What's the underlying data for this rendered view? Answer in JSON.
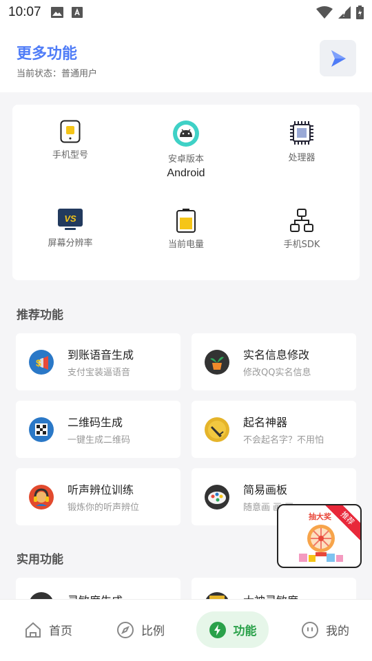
{
  "status_bar": {
    "time": "10:07"
  },
  "header": {
    "title": "更多功能",
    "status_label": "当前状态：",
    "status_value": "普通用户"
  },
  "device_info": {
    "items": [
      {
        "label": "手机型号",
        "value": "",
        "icon": "phone-icon"
      },
      {
        "label": "安卓版本",
        "value": "Android",
        "icon": "android-icon"
      },
      {
        "label": "处理器",
        "value": "",
        "icon": "cpu-icon"
      },
      {
        "label": "屏幕分辨率",
        "value": "",
        "icon": "monitor-icon"
      },
      {
        "label": "当前电量",
        "value": "",
        "icon": "battery-icon"
      },
      {
        "label": "手机SDK",
        "value": "",
        "icon": "hierarchy-icon"
      }
    ]
  },
  "recommended": {
    "title": "推荐功能",
    "items": [
      {
        "title": "到账语音生成",
        "subtitle": "支付宝装逼语音",
        "icon": "money-speaker-icon"
      },
      {
        "title": "实名信息修改",
        "subtitle": "修改QQ实名信息",
        "icon": "plant-pot-icon"
      },
      {
        "title": "二维码生成",
        "subtitle": "一键生成二维码",
        "icon": "qrcode-icon"
      },
      {
        "title": "起名神器",
        "subtitle": "不会起名字？不用怕",
        "icon": "pen-icon"
      },
      {
        "title": "听声辨位训练",
        "subtitle": "锻炼你的听声辨位",
        "icon": "headphones-icon"
      },
      {
        "title": "简易画板",
        "subtitle": "随意画 画 画",
        "icon": "palette-icon"
      }
    ]
  },
  "utility": {
    "title": "实用功能",
    "items": [
      {
        "title": "灵敏度生成",
        "icon": "sensitivity-icon"
      },
      {
        "title": "大神灵敏度",
        "icon": "pro-sensitivity-icon"
      }
    ]
  },
  "promo": {
    "title": "抽大奖",
    "badge": "推荐"
  },
  "bottom_nav": {
    "items": [
      {
        "label": "首页",
        "icon": "home-icon"
      },
      {
        "label": "比例",
        "icon": "compass-icon"
      },
      {
        "label": "功能",
        "icon": "bolt-icon"
      },
      {
        "label": "我的",
        "icon": "face-icon"
      }
    ]
  },
  "colors": {
    "accent": "#4f7cf7",
    "active_nav": "#2aa14a",
    "promo_red": "#e8283a"
  }
}
